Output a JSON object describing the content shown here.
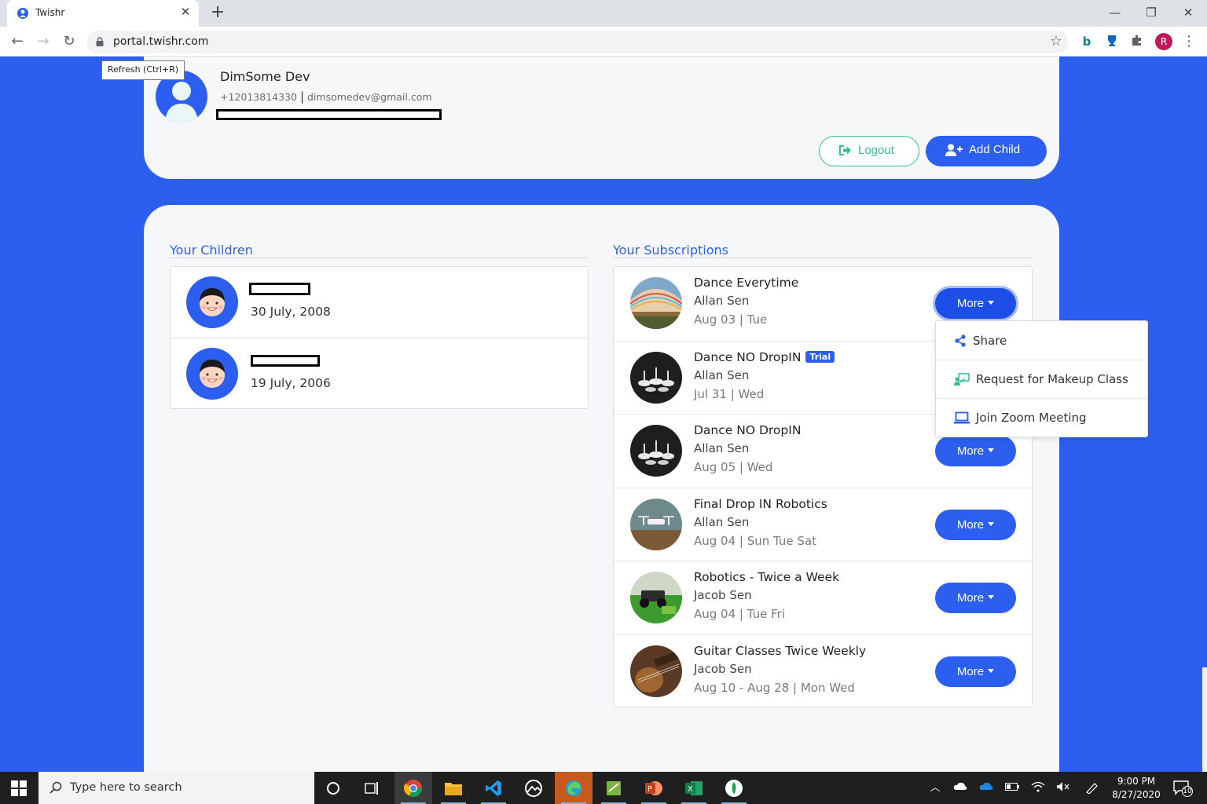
{
  "browser": {
    "tab_title": "Twishr",
    "url": "portal.twishr.com",
    "tooltip": "Refresh (Ctrl+R)",
    "profile_initial": "R",
    "icons": [
      "back-icon",
      "forward-icon",
      "reload-icon",
      "lock-icon",
      "star-icon",
      "bing-icon",
      "trophy-extension-icon",
      "puzzle-extensions-icon",
      "menu-dots-icon"
    ]
  },
  "profile": {
    "name": "DimSome Dev",
    "phone": "+12013814330",
    "separator": "|",
    "email": "dimsomedev@gmail.com",
    "logout_label": "Logout",
    "add_child_label": "Add Child"
  },
  "children": {
    "title": "Your Children",
    "items": [
      {
        "dob": "30 July, 2008"
      },
      {
        "dob": "19 July, 2006"
      }
    ]
  },
  "subscriptions": {
    "title": "Your Subscriptions",
    "more_label": "More",
    "items": [
      {
        "name": "Dance Everytime",
        "badge": "",
        "teacher": "Allan Sen",
        "schedule": "Aug 03 | Tue"
      },
      {
        "name": "Dance NO DropIN",
        "badge": "Trial",
        "teacher": "Allan Sen",
        "schedule": "Jul 31 | Wed"
      },
      {
        "name": "Dance NO DropIN",
        "badge": "",
        "teacher": "Allan Sen",
        "schedule": "Aug 05 | Wed"
      },
      {
        "name": "Final Drop IN Robotics",
        "badge": "",
        "teacher": "Allan Sen",
        "schedule": "Aug 04 | Sun Tue Sat"
      },
      {
        "name": "Robotics - Twice a Week",
        "badge": "",
        "teacher": "Jacob Sen",
        "schedule": "Aug 04 | Tue Fri"
      },
      {
        "name": "Guitar Classes Twice Weekly",
        "badge": "",
        "teacher": "Jacob Sen",
        "schedule": "Aug 10 - Aug 28 | Mon Wed"
      }
    ]
  },
  "dropdown": {
    "items": [
      {
        "label": "Share",
        "icon": "share-icon"
      },
      {
        "label": "Request for Makeup Class",
        "icon": "makeup-class-icon"
      },
      {
        "label": "Join Zoom Meeting",
        "icon": "laptop-icon"
      }
    ]
  },
  "taskbar": {
    "search_placeholder": "Type here to search",
    "time": "9:00 PM",
    "date": "8/27/2020",
    "notification_count": "10"
  },
  "colors": {
    "brand_blue": "#2c5ff0",
    "logout_green": "#2ec28e",
    "card_bg": "#f6f7f9"
  }
}
